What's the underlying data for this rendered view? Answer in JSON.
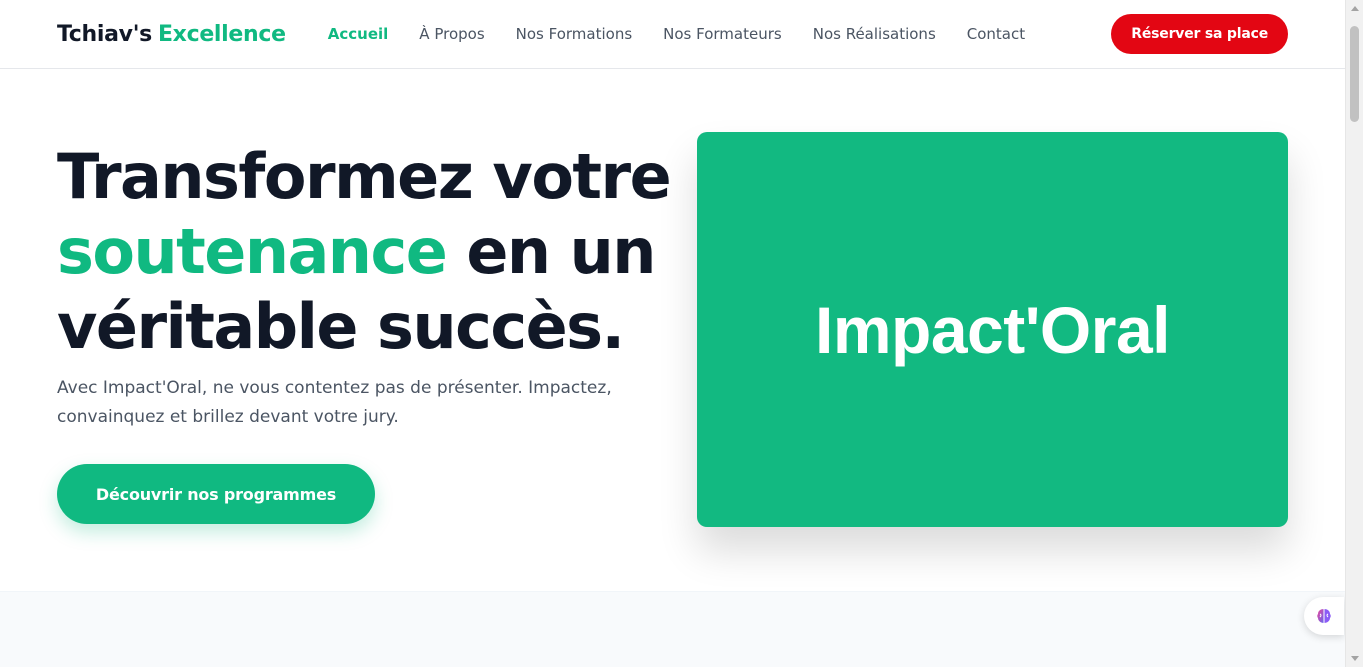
{
  "header": {
    "logo_part1": "Tchiav's",
    "logo_part2": "Excellence",
    "nav": [
      {
        "label": "Accueil"
      },
      {
        "label": "À Propos"
      },
      {
        "label": "Nos Formations"
      },
      {
        "label": "Nos Formateurs"
      },
      {
        "label": "Nos Réalisations"
      },
      {
        "label": "Contact"
      }
    ],
    "cta_label": "Réserver sa place"
  },
  "hero": {
    "headline_part1": "Transformez votre",
    "headline_accent": "soutenance",
    "headline_part2": "en un véritable succès.",
    "lead": "Avec Impact'Oral, ne vous contentez pas de présenter. Impactez, convainquez et brillez devant votre jury.",
    "cta_label": "Découvrir nos programmes",
    "brand_card_text": "Impact'Oral"
  },
  "floating_button": {
    "icon": "brain-icon"
  },
  "colors": {
    "accent_green": "#10b981",
    "cta_red": "#e30613",
    "heading": "#111827",
    "body_text": "#4b5563"
  }
}
